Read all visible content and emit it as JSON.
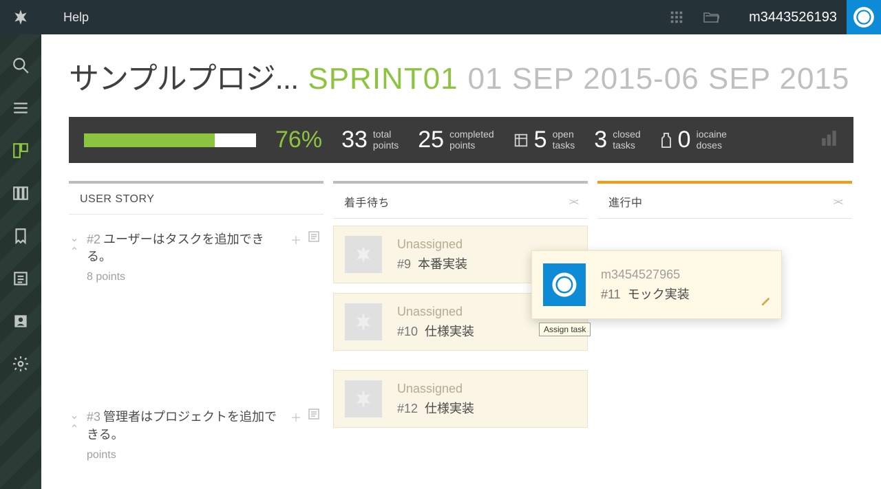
{
  "topbar": {
    "help_label": "Help",
    "username": "m3443526193"
  },
  "title": {
    "project": "サンプルプロジ...",
    "sprint": "SPRINT01",
    "dates": "01 SEP 2015-06 SEP 2015"
  },
  "stats": {
    "percent": "76%",
    "total_points": {
      "value": "33",
      "label_top": "total",
      "label_bot": "points"
    },
    "completed_points": {
      "value": "25",
      "label_top": "completed",
      "label_bot": "points"
    },
    "open_tasks": {
      "value": "5",
      "label_top": "open",
      "label_bot": "tasks"
    },
    "closed_tasks": {
      "value": "3",
      "label_top": "closed",
      "label_bot": "tasks"
    },
    "iocaine": {
      "value": "0",
      "label_top": "iocaine",
      "label_bot": "doses"
    },
    "progress_width": 76
  },
  "columns": {
    "stories_header": "USER STORY",
    "waiting_header": "着手待ち",
    "inprogress_header": "進行中"
  },
  "stories": [
    {
      "ref": "#2",
      "title": "ユーザーはタスクを追加できる。",
      "points_prefix": "8",
      "points_suffix": "points"
    },
    {
      "ref": "#3",
      "title": "管理者はプロジェクトを追加できる。",
      "points_prefix": "",
      "points_suffix": "points"
    }
  ],
  "cards_waiting": [
    {
      "assignee": "Unassigned",
      "ref": "#9",
      "title": "本番実装"
    },
    {
      "assignee": "Unassigned",
      "ref": "#10",
      "title": "仕様実装"
    },
    {
      "assignee": "Unassigned",
      "ref": "#12",
      "title": "仕様実装"
    }
  ],
  "cards_inprogress": [
    {
      "assignee": "m3454527965",
      "ref": "#11",
      "title": "モック実装"
    }
  ],
  "tooltip": "Assign task"
}
